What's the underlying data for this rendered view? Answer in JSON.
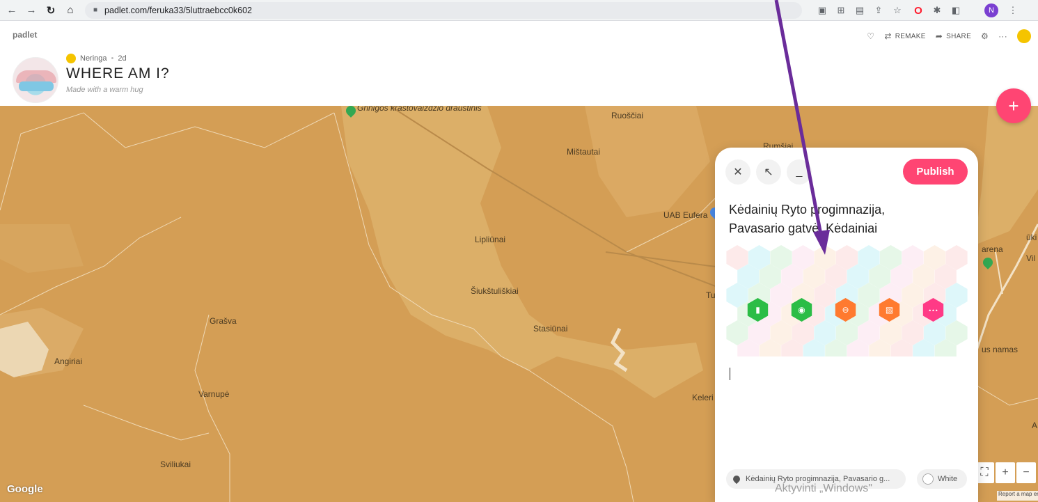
{
  "browser": {
    "url": "padlet.com/feruka33/5luttraebcc0k602",
    "profile_initial": "N",
    "icons": [
      "back-icon",
      "forward-icon",
      "reload-icon",
      "home-icon",
      "lock-icon",
      "cast-icon",
      "install-icon",
      "share-icon",
      "star-icon",
      "opera-icon",
      "puzzle-icon",
      "sidebar-icon",
      "menu-icon"
    ]
  },
  "padlet": {
    "brand": "padlet",
    "actions": {
      "remake": "REMAKE",
      "share": "SHARE"
    },
    "author": "Neringa",
    "age": "2d",
    "title": "WHERE AM I?",
    "subtitle": "Made with a warm hug"
  },
  "map": {
    "places": [
      "Grinigos kraštovaizdžio draustinis",
      "Ruoščiai",
      "Mištautai",
      "Rumšiai",
      "UAB Eufera",
      "Lipliūnai",
      "Šiukštuliškiai",
      "Grašva",
      "Stasiūnai",
      "Angiriai",
      "Varnupė",
      "Keleri",
      "Sviliukai",
      "Tu",
      "arena",
      "Vil",
      "ūki",
      "us namas",
      "A"
    ],
    "google_label": "Google",
    "report_label": "Report a map error"
  },
  "composer": {
    "publish_label": "Publish",
    "post_title": "Kėdainių Ryto progimnazija, Pavasario gatvė, Kėdainiai",
    "attachments": [
      {
        "name": "upload-file-icon",
        "color": "#2bbd46"
      },
      {
        "name": "camera-icon",
        "color": "#2bbd46"
      },
      {
        "name": "link-icon",
        "color": "#ff7a2f"
      },
      {
        "name": "image-search-icon",
        "color": "#ff7a2f"
      },
      {
        "name": "more-icon",
        "color": "#ff3a86"
      }
    ],
    "location_chip": "Kėdainių Ryto progimnazija, Pavasario g...",
    "color_label": "White"
  },
  "os": {
    "watermark": "Aktyvinti „Windows\""
  },
  "colors": {
    "accent": "#ff4573",
    "map_base": "#d49e55",
    "annotation_arrow": "#6a2c9a"
  }
}
